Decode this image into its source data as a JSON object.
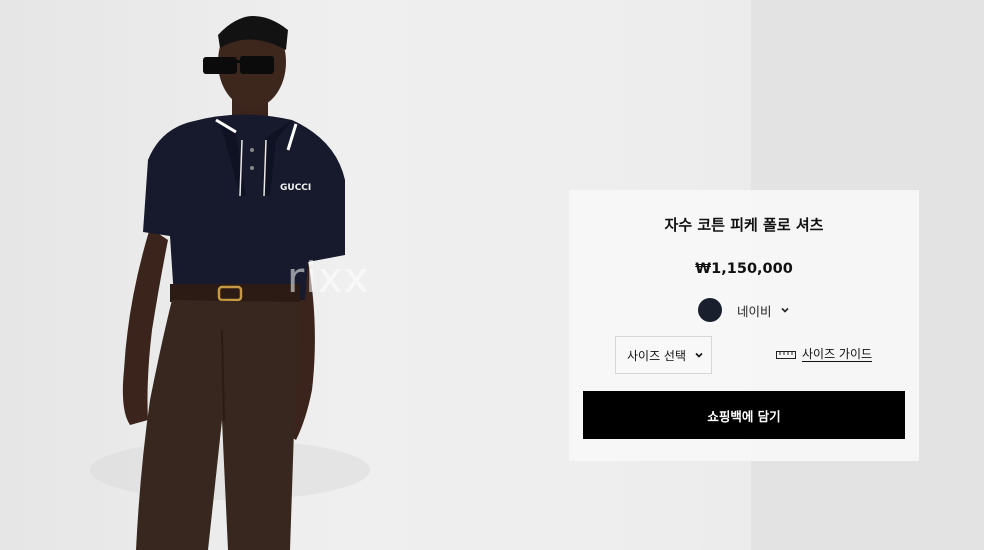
{
  "watermarks": [
    "rixx",
    "rixx"
  ],
  "product": {
    "name": "자수 코튼 피케 폴로 셔츠",
    "price": "₩1,150,000",
    "color_name": "네이비",
    "color_swatch": "#1a1f2e"
  },
  "size_select": {
    "label": "사이즈 선택"
  },
  "size_guide": {
    "label": "사이즈 가이드"
  },
  "cart_button": {
    "label": "쇼핑백에 담기"
  },
  "photo": {
    "logo_text": "GUCCI"
  },
  "icons": {
    "color_dropdown": "chevron-down-icon",
    "size_dropdown": "chevron-down-icon",
    "size_guide": "ruler-icon"
  }
}
